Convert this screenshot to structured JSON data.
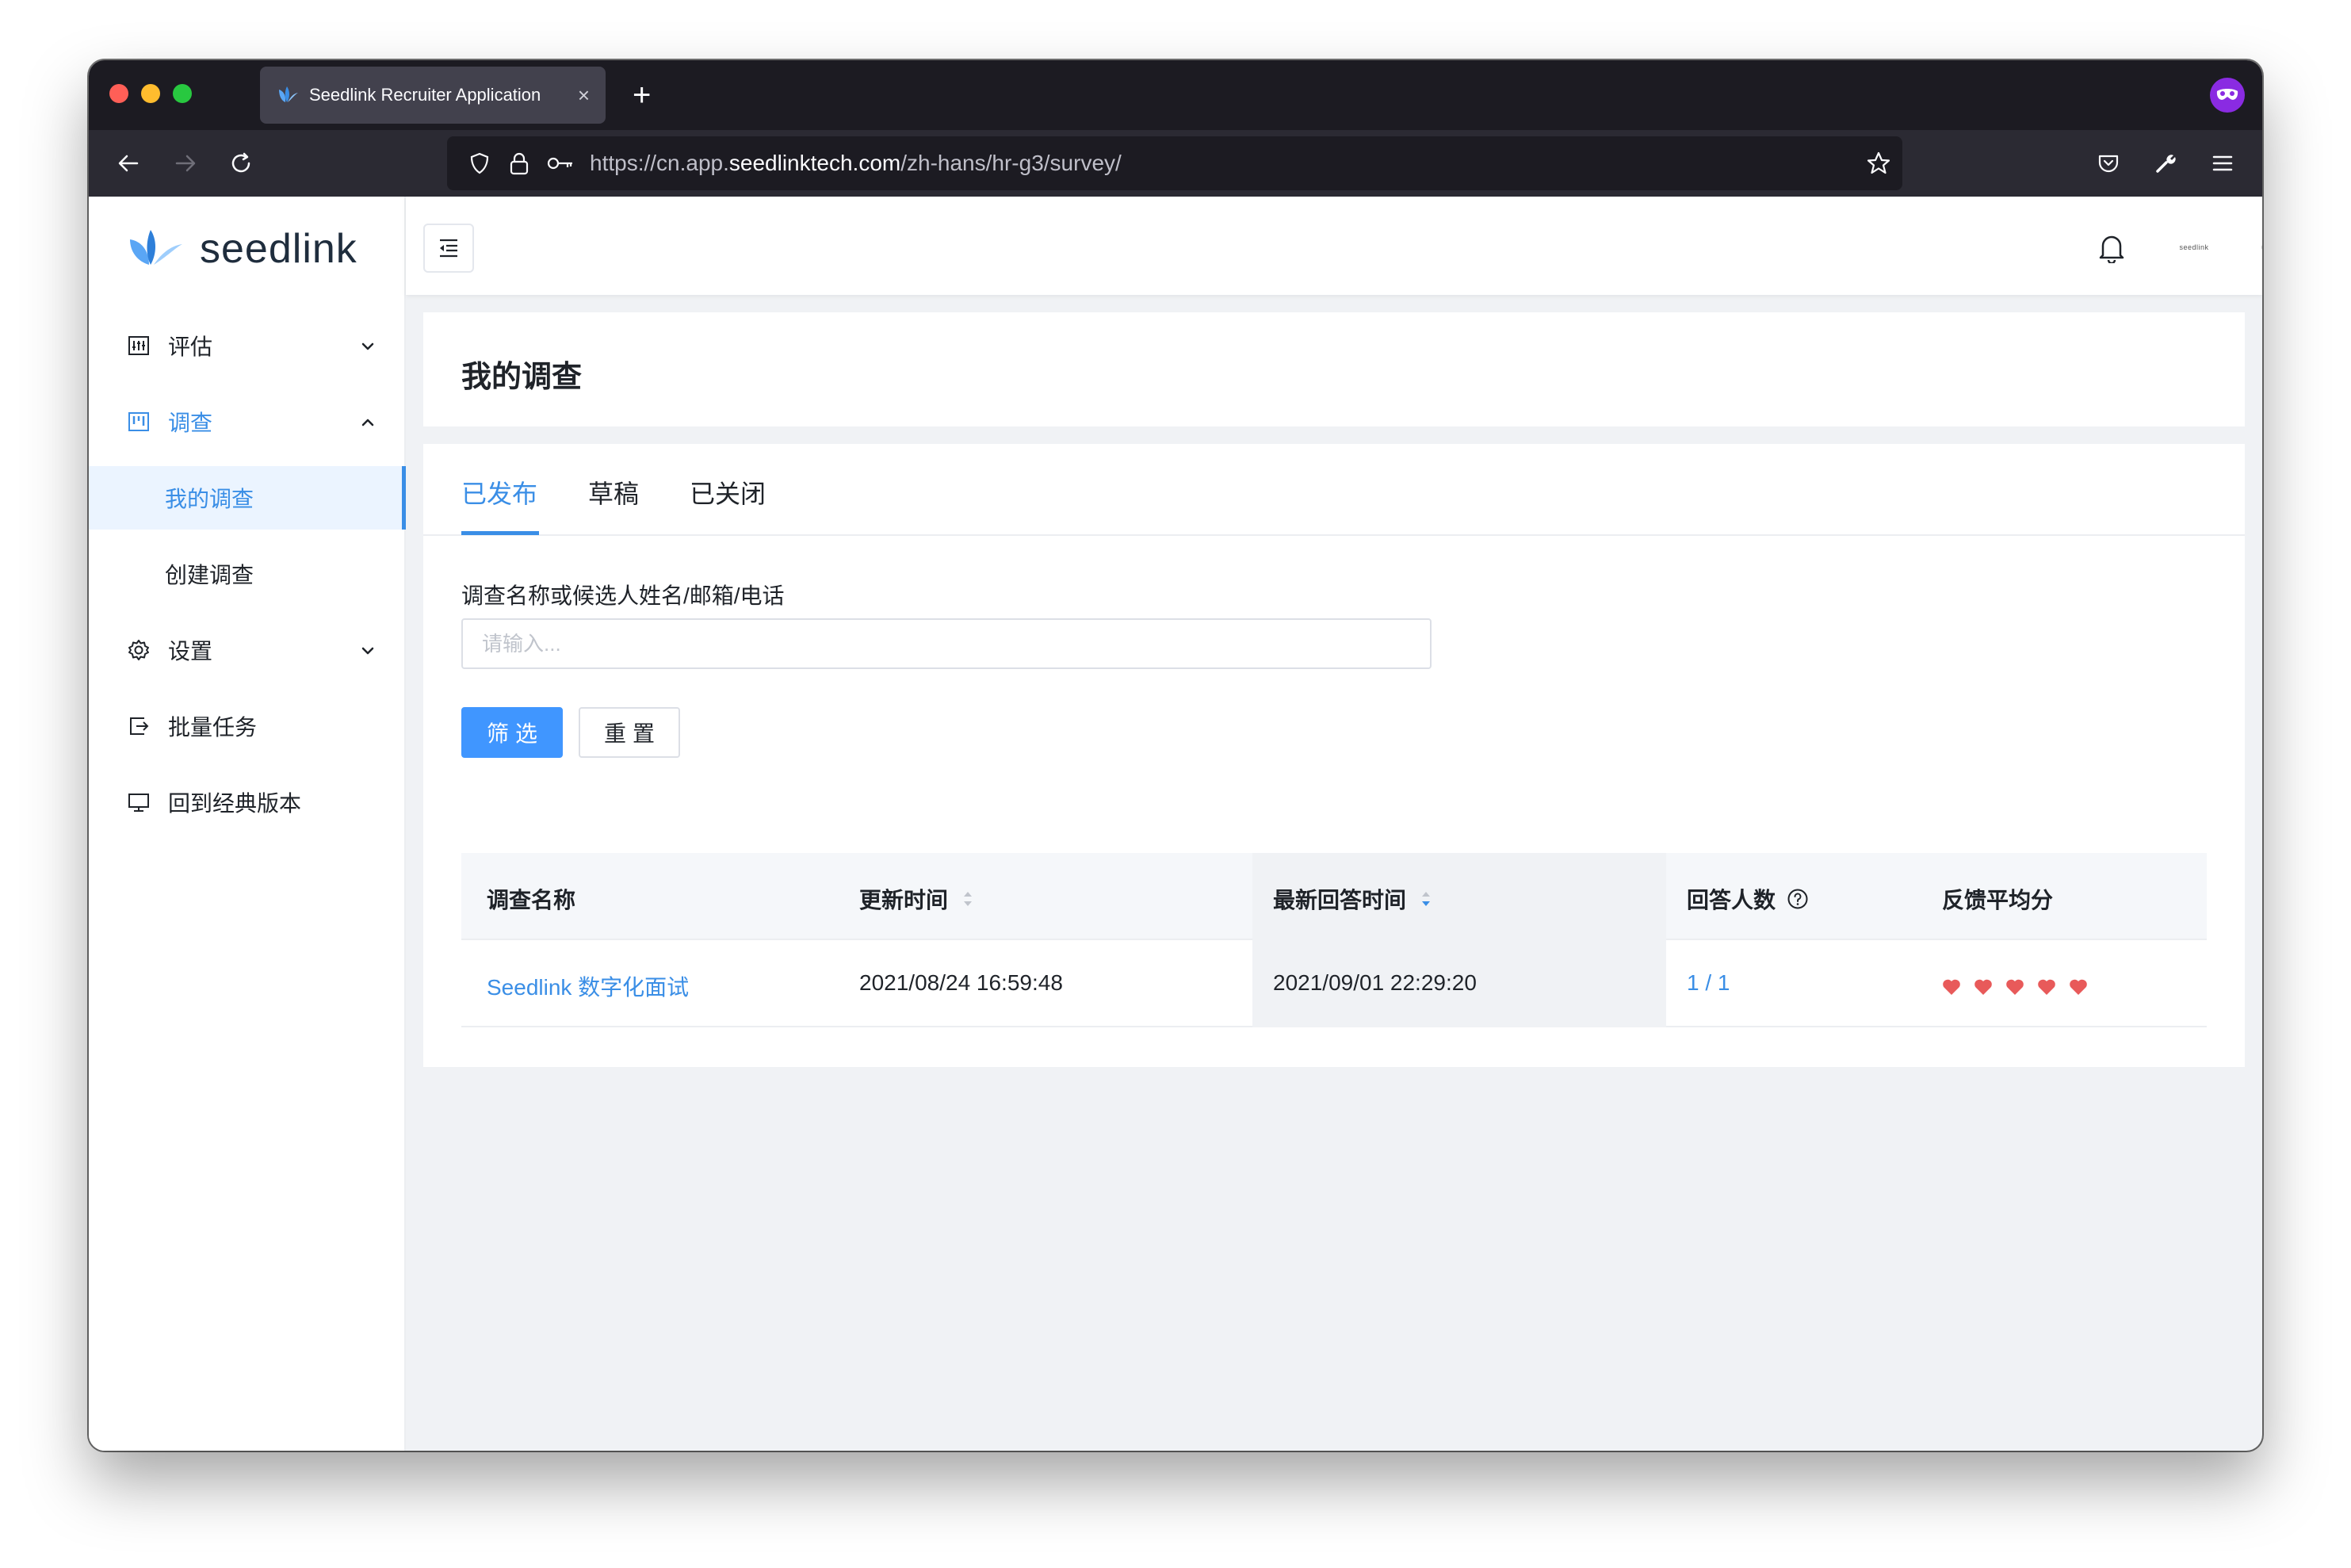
{
  "browser": {
    "tab_title": "Seedlink Recruiter Application",
    "tab_close": "×",
    "new_tab": "+",
    "url_prefix": "https://cn.app.",
    "url_domain": "seedlinktech.com",
    "url_path": "/zh-hans/hr-g3/survey/"
  },
  "sidebar": {
    "logo_text": "seedlink",
    "items": [
      {
        "label": "评估",
        "icon": "chart-icon"
      },
      {
        "label": "调查",
        "icon": "survey-icon"
      },
      {
        "label": "设置",
        "icon": "gear-icon"
      },
      {
        "label": "批量任务",
        "icon": "export-icon"
      },
      {
        "label": "回到经典版本",
        "icon": "monitor-icon"
      }
    ],
    "sub_items": [
      {
        "label": "我的调查"
      },
      {
        "label": "创建调查"
      }
    ]
  },
  "topbar": {
    "avatar_text": "seedlink"
  },
  "page": {
    "title": "我的调查",
    "tabs": [
      {
        "label": "已发布"
      },
      {
        "label": "草稿"
      },
      {
        "label": "已关闭"
      }
    ],
    "filter_label": "调查名称或候选人姓名/邮箱/电话",
    "filter_placeholder": "请输入...",
    "filter_button": "筛选",
    "reset_button": "重置"
  },
  "table": {
    "columns": [
      "调查名称",
      "更新时间",
      "最新回答时间",
      "回答人数",
      "反馈平均分"
    ],
    "rows": [
      {
        "name": "Seedlink 数字化面试",
        "updated": "2021/08/24 16:59:48",
        "latest_answer": "2021/09/01 22:29:20",
        "respondents": "1 / 1",
        "rating": 5
      }
    ]
  },
  "colors": {
    "accent": "#3a8ee6",
    "heart": "#e85a5a"
  }
}
